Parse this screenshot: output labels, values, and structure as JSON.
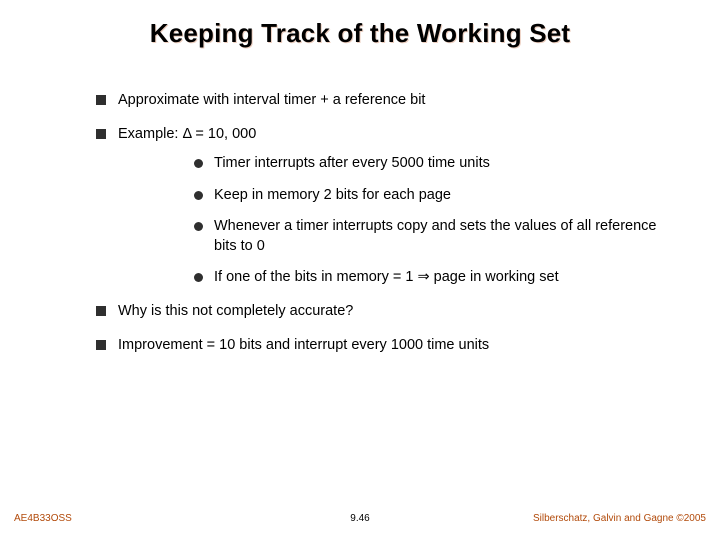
{
  "title": "Keeping Track of the Working Set",
  "bullets": {
    "b1": "Approximate with interval timer + a reference bit",
    "b2": "Example: Δ = 10, 000",
    "b2_sub": {
      "s1": "Timer interrupts after every 5000 time units",
      "s2": "Keep in memory 2 bits for each page",
      "s3": "Whenever a timer interrupts copy and sets the values of all reference bits to 0",
      "s4": "If one of the bits in memory = 1 ⇒ page in working set"
    },
    "b3": "Why is this not completely accurate?",
    "b4": "Improvement = 10 bits and interrupt every 1000 time units"
  },
  "footer": {
    "left": "AE4B33OSS",
    "center": "9.46",
    "right": "Silberschatz, Galvin and Gagne ©2005"
  }
}
